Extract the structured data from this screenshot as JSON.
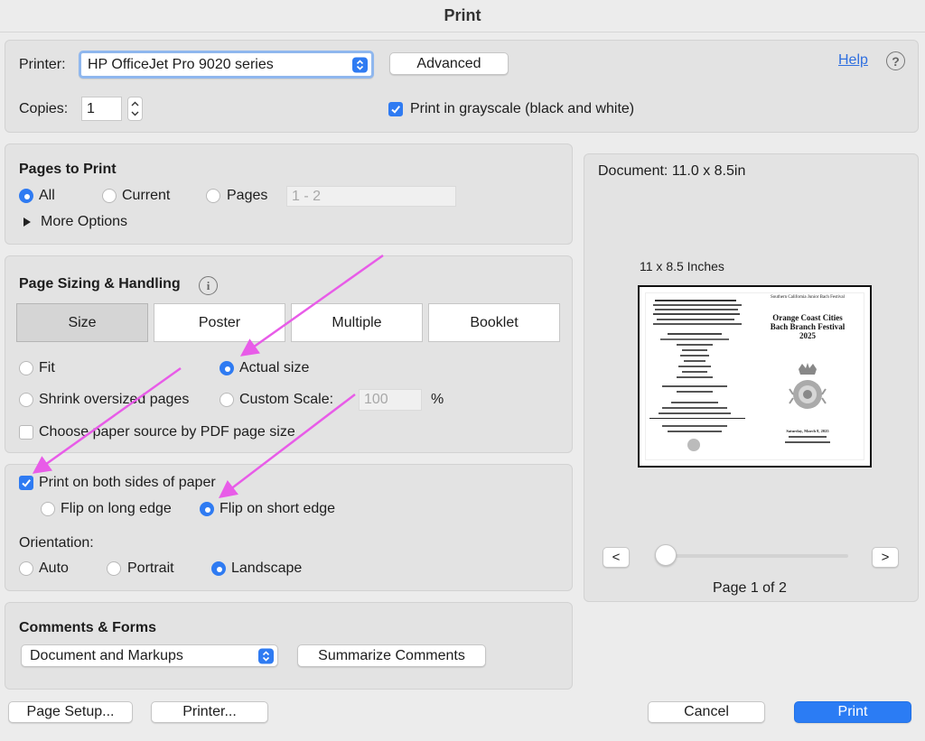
{
  "window": {
    "title": "Print"
  },
  "printer": {
    "label": "Printer:",
    "selected": "HP OfficeJet Pro 9020 series",
    "advanced_label": "Advanced",
    "help_label": "Help",
    "help_icon_glyph": "?",
    "copies_label": "Copies:",
    "copies_value": "1",
    "grayscale_label": "Print in grayscale (black and white)",
    "grayscale_checked": true
  },
  "pages_to_print": {
    "heading": "Pages to Print",
    "options": [
      "All",
      "Current",
      "Pages"
    ],
    "selected": "All",
    "range_placeholder": "1 - 2",
    "more_options_label": "More Options"
  },
  "page_sizing": {
    "heading": "Page Sizing & Handling",
    "info_icon_glyph": "i",
    "tabs": [
      "Size",
      "Poster",
      "Multiple",
      "Booklet"
    ],
    "selected_tab": "Size",
    "fit_label": "Fit",
    "actual_size_label": "Actual size",
    "shrink_label": "Shrink oversized pages",
    "custom_scale_label": "Custom Scale:",
    "custom_scale_value": "100",
    "percent_sign": "%",
    "selected": "Actual size",
    "paper_source_label": "Choose paper source by PDF page size",
    "paper_source_checked": false
  },
  "duplex": {
    "both_sides_label": "Print on both sides of paper",
    "both_sides_checked": true,
    "flip_long_label": "Flip on long edge",
    "flip_short_label": "Flip on short edge",
    "selected": "Flip on short edge",
    "orientation_label": "Orientation:",
    "orientation_options": [
      "Auto",
      "Portrait",
      "Landscape"
    ],
    "orientation_selected": "Landscape"
  },
  "comments_forms": {
    "heading": "Comments & Forms",
    "selected": "Document and Markups",
    "summarize_label": "Summarize Comments"
  },
  "preview": {
    "document_size": "Document: 11.0 x 8.5in",
    "paper_size_label": "11 x 8.5 Inches",
    "prev_glyph": "<",
    "next_glyph": ">",
    "page_indicator": "Page 1 of 2",
    "slider_position": 0,
    "content": {
      "left_column_fragments": [],
      "right_header": "Southern California Junior Bach Festival",
      "right_title_lines": [
        "Orange Coast Cities",
        "Bach Branch Festival",
        "2025"
      ],
      "right_date_lines": [
        "Saturday, March 8, 2025"
      ]
    }
  },
  "footer": {
    "page_setup_label": "Page Setup...",
    "printer_label": "Printer...",
    "cancel_label": "Cancel",
    "print_label": "Print"
  },
  "colors": {
    "accent": "#2f7bf2",
    "annotation_arrow": "#e85ce8",
    "link": "#2f6fe0"
  }
}
